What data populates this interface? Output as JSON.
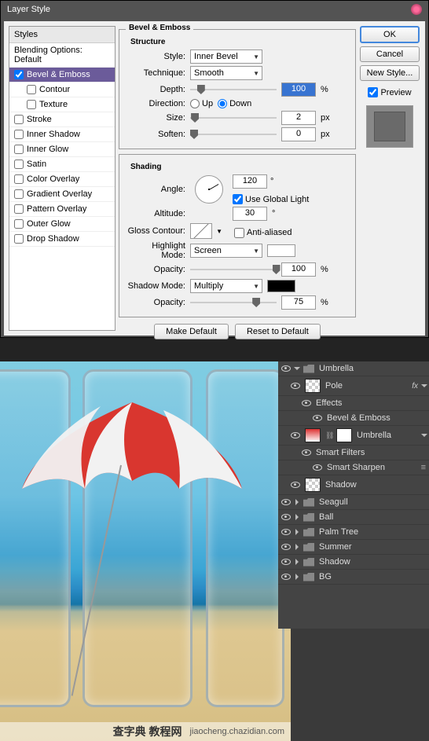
{
  "dialog": {
    "title": "Layer Style",
    "styles_header": "Styles",
    "blending_options": "Blending Options: Default",
    "items": {
      "bevel_emboss": "Bevel & Emboss",
      "contour": "Contour",
      "texture": "Texture",
      "stroke": "Stroke",
      "inner_shadow": "Inner Shadow",
      "inner_glow": "Inner Glow",
      "satin": "Satin",
      "color_overlay": "Color Overlay",
      "gradient_overlay": "Gradient Overlay",
      "pattern_overlay": "Pattern Overlay",
      "outer_glow": "Outer Glow",
      "drop_shadow": "Drop Shadow"
    },
    "fieldset_title": "Bevel & Emboss",
    "structure": {
      "heading": "Structure",
      "style_label": "Style:",
      "style_value": "Inner Bevel",
      "technique_label": "Technique:",
      "technique_value": "Smooth",
      "depth_label": "Depth:",
      "depth_value": "100",
      "depth_unit": "%",
      "direction_label": "Direction:",
      "up": "Up",
      "down": "Down",
      "size_label": "Size:",
      "size_value": "2",
      "size_unit": "px",
      "soften_label": "Soften:",
      "soften_value": "0",
      "soften_unit": "px"
    },
    "shading": {
      "heading": "Shading",
      "angle_label": "Angle:",
      "angle_value": "120",
      "deg": "°",
      "use_global": "Use Global Light",
      "altitude_label": "Altitude:",
      "altitude_value": "30",
      "gloss_label": "Gloss Contour:",
      "anti_aliased": "Anti-aliased",
      "highlight_label": "Highlight Mode:",
      "highlight_value": "Screen",
      "opacity_label": "Opacity:",
      "h_opacity_value": "100",
      "shadow_label": "Shadow Mode:",
      "shadow_value": "Multiply",
      "s_opacity_value": "75",
      "pct": "%"
    },
    "make_default": "Make Default",
    "reset_default": "Reset to Default",
    "ok": "OK",
    "cancel": "Cancel",
    "new_style": "New Style...",
    "preview": "Preview"
  },
  "layers": {
    "umbrella_group": "Umbrella",
    "pole": "Pole",
    "effects": "Effects",
    "bevel_emboss": "Bevel & Emboss",
    "umbrella": "Umbrella",
    "smart_filters": "Smart Filters",
    "smart_sharpen": "Smart Sharpen",
    "shadow": "Shadow",
    "seagull": "Seagull",
    "ball": "Ball",
    "palm_tree": "Palm Tree",
    "summer": "Summer",
    "shadow2": "Shadow",
    "bg": "BG",
    "fx": "fx"
  },
  "watermark": {
    "cn": "查字典  教程网",
    "url": "jiaocheng.chazidian.com"
  }
}
